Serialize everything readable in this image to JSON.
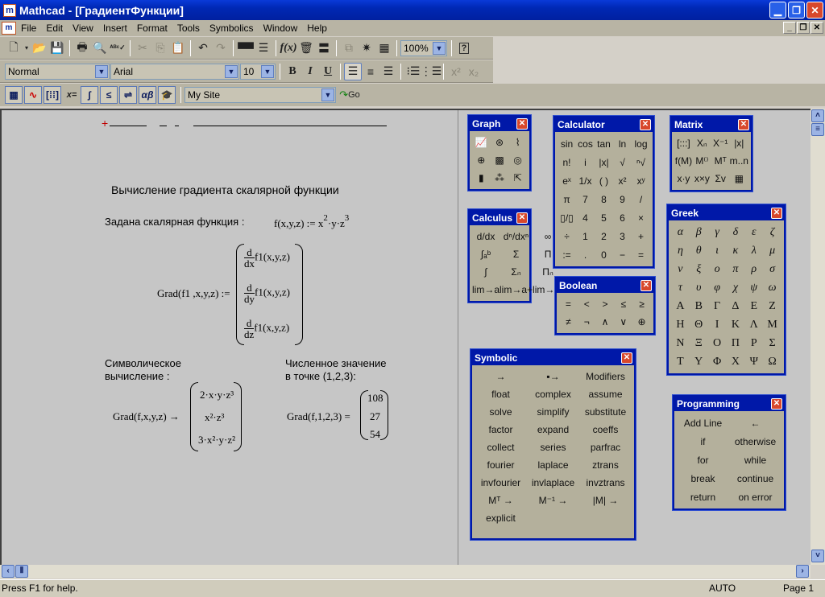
{
  "window": {
    "title": "Mathcad - [ГрадиентФункции]",
    "app_icon": "mathcad-logo-icon",
    "controls": [
      "minimize-icon",
      "restore-icon",
      "close-icon"
    ]
  },
  "menu": {
    "items": [
      "File",
      "Edit",
      "View",
      "Insert",
      "Format",
      "Tools",
      "Symbolics",
      "Window",
      "Help"
    ],
    "mdi_controls": [
      "_",
      "❐",
      "✕"
    ]
  },
  "toolbar_standard": {
    "buttons": [
      "new",
      "open",
      "save",
      "print",
      "print-preview",
      "spell-check",
      "cut",
      "copy",
      "paste",
      "undo",
      "redo",
      "align-across",
      "align-down",
      "insert-function",
      "insert-unit",
      "calculate",
      "component",
      "resources",
      "insert-hyperlink",
      "help"
    ],
    "zoom": "100%"
  },
  "toolbar_format": {
    "style": "Normal",
    "font": "Arial",
    "size": "10",
    "bold": "B",
    "italic": "I",
    "underline": "U"
  },
  "toolbar_math": {
    "eq_label": "x=",
    "resources_combo": "My Site",
    "go_label": "Go"
  },
  "document": {
    "heading": "Вычисление градиента скалярной функции",
    "given_label": "Задана скалярная функция :",
    "func_def": {
      "lhs": "f(x,y,z) :=",
      "base1": "x",
      "exp1": "2",
      "mid": "·y·z",
      "exp2": "3"
    },
    "grad_def": {
      "lhs": "Grad(f1 ,x,y,z) :=",
      "rows": [
        {
          "num": "d",
          "den": "dx",
          "body": "f1(x,y,z)"
        },
        {
          "num": "d",
          "den": "dy",
          "body": "f1(x,y,z)"
        },
        {
          "num": "d",
          "den": "dz",
          "body": "f1(x,y,z)"
        }
      ]
    },
    "symbolic_label_1": "Символическое",
    "symbolic_label_2": "вычисление :",
    "symbolic_eval": {
      "lhs": "Grad(f,x,y,z) →",
      "rows": [
        "2·x·y·z³",
        "x²·z³",
        "3·x²·y·z²"
      ]
    },
    "numeric_label_1": "Численное значение",
    "numeric_label_2": "в точке (1,2,3):",
    "numeric_eval": {
      "lhs": "Grad(f,1,2,3) =",
      "values": [
        "108",
        "27",
        "54"
      ]
    }
  },
  "palettes": {
    "graph": {
      "title": "Graph",
      "icons": [
        "xy-plot-icon",
        "polar-plot-icon",
        "surface-plot-icon",
        "polar-grid-icon",
        "3d-surface-icon",
        "contour-plot-icon",
        "3d-bar-icon",
        "3d-scatter-icon",
        "vector-field-icon"
      ]
    },
    "calculus": {
      "title": "Calculus",
      "items": [
        "d/dx",
        "dⁿ/dxⁿ",
        "∞",
        "∫ₐᵇ",
        "Σ",
        "Π",
        "∫",
        "Σₙ",
        "Πₙ",
        "lim→a",
        "lim→a+",
        "lim→a-"
      ]
    },
    "calculator": {
      "title": "Calculator",
      "items": [
        "sin",
        "cos",
        "tan",
        "ln",
        "log",
        "n!",
        "i",
        "|x|",
        "√",
        "ⁿ√",
        "eˣ",
        "1/x",
        "( )",
        "x²",
        "xʸ",
        "π",
        "7",
        "8",
        "9",
        "/",
        "▯/▯",
        "4",
        "5",
        "6",
        "×",
        "÷",
        "1",
        "2",
        "3",
        "+",
        ":=",
        ".",
        "0",
        "−",
        "="
      ]
    },
    "boolean": {
      "title": "Boolean",
      "items": [
        "=",
        "<",
        ">",
        "≤",
        "≥",
        "≠",
        "¬",
        "∧",
        "∨",
        "⊕"
      ]
    },
    "matrix": {
      "title": "Matrix",
      "items": [
        "[:::]",
        "Xₙ",
        "X⁻¹",
        "|x|",
        "f(M)",
        "M⁽⁾",
        "Mᵀ",
        "m..n",
        "x·y",
        "x×y",
        "Σv",
        "▦"
      ]
    },
    "greek": {
      "title": "Greek",
      "lower": [
        "α",
        "β",
        "γ",
        "δ",
        "ε",
        "ζ",
        "η",
        "θ",
        "ι",
        "κ",
        "λ",
        "μ",
        "ν",
        "ξ",
        "ο",
        "π",
        "ρ",
        "σ",
        "τ",
        "υ",
        "φ",
        "χ",
        "ψ",
        "ω"
      ],
      "upper": [
        "Α",
        "Β",
        "Γ",
        "Δ",
        "Ε",
        "Ζ",
        "Η",
        "Θ",
        "Ι",
        "Κ",
        "Λ",
        "Μ",
        "Ν",
        "Ξ",
        "Ο",
        "Π",
        "Ρ",
        "Σ",
        "Τ",
        "Υ",
        "Φ",
        "Χ",
        "Ψ",
        "Ω"
      ]
    },
    "symbolic": {
      "title": "Symbolic",
      "items": [
        "→",
        "▪→",
        "Modifiers",
        "float",
        "complex",
        "assume",
        "solve",
        "simplify",
        "substitute",
        "factor",
        "expand",
        "coeffs",
        "collect",
        "series",
        "parfrac",
        "fourier",
        "laplace",
        "ztrans",
        "invfourier",
        "invlaplace",
        "invztrans",
        "Mᵀ →",
        "M⁻¹ →",
        "|M| →",
        "explicit"
      ]
    },
    "programming": {
      "title": "Programming",
      "items": [
        "Add Line",
        "←",
        "if",
        "otherwise",
        "for",
        "while",
        "break",
        "continue",
        "return",
        "on error"
      ]
    }
  },
  "status": {
    "help": "Press F1 for help.",
    "mode": "AUTO",
    "page": "Page 1"
  }
}
